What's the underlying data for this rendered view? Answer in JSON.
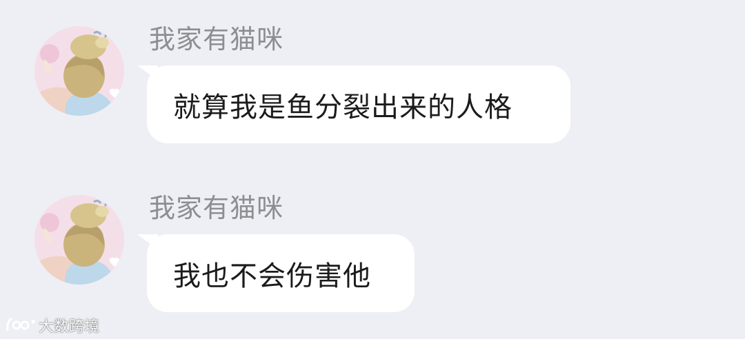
{
  "messages": [
    {
      "sender": "我家有猫咪",
      "text": "就算我是鱼分裂出来的人格"
    },
    {
      "sender": "我家有猫咪",
      "text": "我也不会伤害他"
    }
  ],
  "watermark": {
    "text": "大数跨境",
    "icon": "brand-logo-icon"
  },
  "colors": {
    "background": "#eeeff4",
    "bubble": "#ffffff",
    "sender_text": "#8d8d92",
    "message_text": "#1b1b1b"
  }
}
